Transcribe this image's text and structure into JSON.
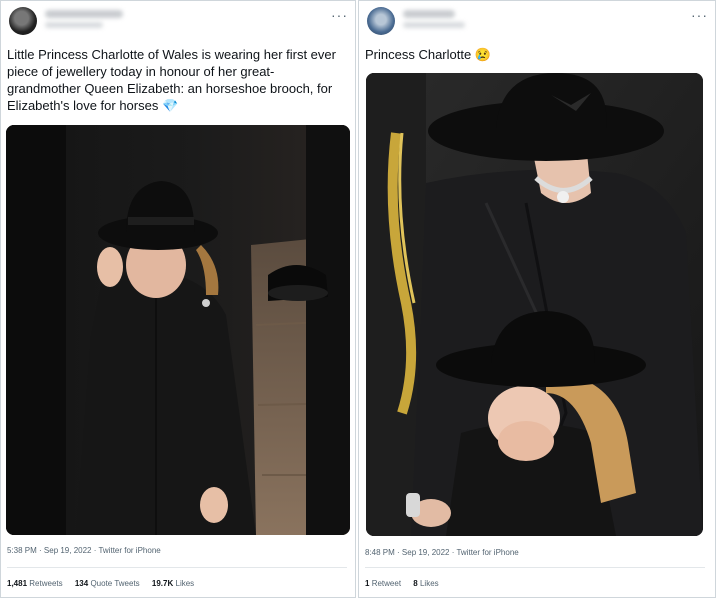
{
  "left_tweet": {
    "text": "Little Princess Charlotte of Wales is wearing her first ever piece of jewellery today in honour of her great-grandmother Queen Elizabeth: an horseshoe brooch, for Elizabeth's love for horses",
    "emoji": "💎",
    "more_label": "···",
    "meta": "5:38 PM · Sep 19, 2022 · Twitter for iPhone",
    "stats": [
      {
        "count": "1,481",
        "label": "Retweets"
      },
      {
        "count": "134",
        "label": "Quote Tweets"
      },
      {
        "count": "19.7K",
        "label": "Likes"
      }
    ]
  },
  "right_tweet": {
    "text": "Princess Charlotte",
    "emoji": "😢",
    "more_label": "···",
    "meta": "8:48 PM · Sep 19, 2022 · Twitter for iPhone",
    "stats": [
      {
        "count": "1",
        "label": "Retweet"
      },
      {
        "count": "8",
        "label": "Likes"
      }
    ]
  },
  "colors": {
    "text": "#0f1419",
    "muted": "#536471",
    "border": "#cfd6db",
    "coat": "#151515",
    "hat": "#0d0d0d"
  }
}
